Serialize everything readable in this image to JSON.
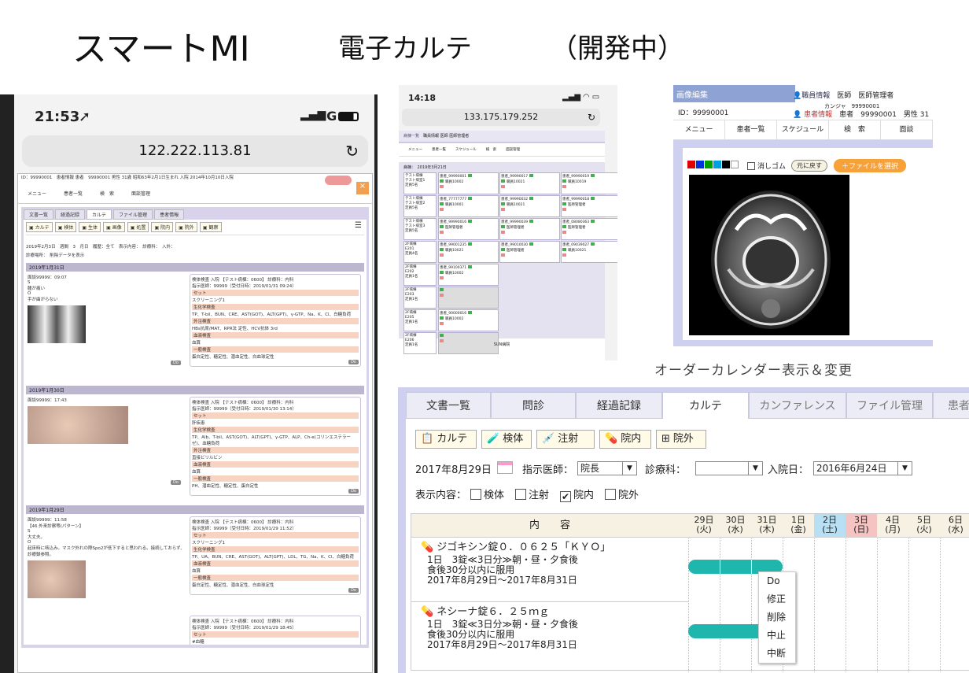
{
  "header": {
    "title": "スマートMI",
    "subtitle": "電子カルテ",
    "status": "（開発中）"
  },
  "phone1": {
    "time": "21:53",
    "signal": "4G",
    "url": "122.222.113.81",
    "patient_line": "ID：99990001　患者情報 患者　99990001 男性 31歳 昭和63年2月1日生まれ 入院 2014年10月10日入院",
    "menu": [
      "メニュー",
      "患者一覧",
      "検　索",
      "面談管理"
    ],
    "tabs": [
      "文書一覧",
      "経過記録",
      "カルテ",
      "ファイル管理",
      "患者情報"
    ],
    "tools": [
      "カルテ",
      "検体",
      "生体",
      "画像",
      "処置",
      "院内",
      "院外",
      "観察"
    ],
    "filter_line": "2019年2月3日　週間　3　月日　履歴：全て　表示内容：　診療科：　入外：",
    "filter_line2": "診療場所：　削除データを表示",
    "days": [
      {
        "date": "2019年1月31日",
        "time": "面談99999：09:07",
        "notes": [
          "S",
          "腫が痛い",
          "O",
          "手が曲がらない"
        ],
        "order_head": "検体検査 入院 【テスト病棟：0600】 診療科：内科",
        "order_sub": "指示医師：99999（受付日時：2019/01/31 09:24）",
        "items": [
          "セット",
          "スクリーニング1",
          "生化学検査",
          "TP、T-bil、BUN、CRE、AST(GOT)、ALT(GPT)、γ-GTP、Na、K、Cl、白糖負荷",
          "外注検査",
          "HBs抗原/MAT、RPR法 定性、HCV抗体 3rd",
          "血液検査",
          "血算",
          "一般検査",
          "蛋白定性、糖定性、潜血定性、白血球定性"
        ]
      },
      {
        "date": "2019年1月30日",
        "time": "面談99999：17:43",
        "order_head": "検体検査 入院 【テスト病棟：0600】 診療科：内科",
        "order_sub": "指示医師：99999（受付日時：2019/01/30 13:14）",
        "items": [
          "セット",
          "肝疾患",
          "生化学検査",
          "TP、Alb、T-bil、AST(GOT)、ALT(GPT)、γ-GTP、ALP、Ch-e(コリンエステラーゼ)、血糖負荷",
          "外注検査",
          "直接ビリルビン",
          "血液検査",
          "血算",
          "一般検査",
          "PH、潜血定性、糖定性、蛋白定性"
        ]
      },
      {
        "date": "2019年1月29日",
        "time": "面談99999：11:58",
        "notes": [
          "【46 外来診察等(パターン】",
          "S",
          "大丈夫。",
          "O",
          "起床時に咳込み。マスク外れの際Spo2が低下すると思われる。接続しておらず、診療録参照。"
        ],
        "order_head": "検体検査 入院 【テスト病棟：0600】 診療科：内科",
        "order_sub": "指示医師：99999（受付日時：2019/01/29 11:52）",
        "items": [
          "セット",
          "スクリーニング1",
          "生化学検査",
          "TP、UA、BUN、CRE、AST(GOT)、ALT(GPT)、LDL、TG、Na、K、Cl、白糖負荷",
          "血液検査",
          "血算",
          "一般検査",
          "蛋白定性、糖定性、潜血定性、白血球定性"
        ],
        "order2_head": "検体検査 入院 【テスト病棟：0600】 診療科：内科",
        "order2_sub": "指示医師：99999（受付日時：2019/01/29 18:45）",
        "items2": [
          "セット",
          "#血糖",
          "生化学検査",
          "TP、AST(GOT)、ALT(GPT)、γ-GTP、Che(コリンエステラーゼ)、CPK、HDL、LDL、TG、Na、K、Cl"
        ]
      }
    ],
    "do_label": "Do"
  },
  "phone2": {
    "time": "14:18",
    "url": "133.175.179.252",
    "header": "職員情報 医師 医師管理者",
    "menu": [
      "メニュー",
      "患者一覧",
      "スケジュール",
      "検　索",
      "面談管理"
    ],
    "date_line": "病棟：　2019年3月21日",
    "footer": "SUN病院",
    "rows": [
      {
        "room": [
          "テスト病棟",
          "テスト病室1",
          "定員5名"
        ],
        "cells": [
          "患者_99990001|職員10002",
          "患者_99990017|職員10021",
          "患者_99990019|職員10019"
        ]
      },
      {
        "room": [
          "テスト病棟",
          "テスト病室2",
          "定員5名"
        ],
        "cells": [
          "患者_77777777|職員10001",
          "患者_99990032|職員10021",
          "患者_99990018|医師管理者"
        ]
      },
      {
        "room": [
          "テスト病棟",
          "テスト病室3",
          "定員5名"
        ],
        "cells": [
          "患者_99990016|医師管理者",
          "患者_99990039|医師管理者",
          "患者_08080363|医師管理者"
        ]
      },
      {
        "room": [
          "2F病棟",
          "E201",
          "定員4名"
        ],
        "cells": [
          "患者_99001235|職員10021",
          "患者_99010030|医師管理者",
          "患者_09039027|職員10021"
        ]
      },
      {
        "room": [
          "2F病棟",
          "E202",
          "定員1名"
        ],
        "cells": [
          "患者_99100371|職員10002"
        ]
      },
      {
        "room": [
          "2F病棟",
          "E203",
          "定員1名"
        ],
        "cells": [
          ""
        ]
      },
      {
        "room": [
          "2F病棟",
          "E205",
          "定員1名"
        ],
        "cells": [
          "患者_90000016|職員10002"
        ]
      },
      {
        "room": [
          "2F病棟",
          "E206",
          "定員1名"
        ],
        "cells": [
          ""
        ]
      }
    ]
  },
  "mri": {
    "header": "画像編集",
    "id_line": "ID：99990001",
    "staff": "職員情報",
    "staff_val": "医師　医師管理者",
    "patient": "患者情報",
    "patient_kana": "カンジャ　99990001",
    "patient_val": "患者　99990001　男性 31",
    "menu": [
      "メニュー",
      "患者一覧",
      "スケジュール",
      "検　索",
      "面談"
    ],
    "swatches": [
      "#e00000",
      "#0030e0",
      "#00a000",
      "#00a0e0",
      "#000000",
      "#ffffff"
    ],
    "eraser": "消しゴム",
    "undo": "元に戻す",
    "file": "＋ファイルを選択",
    "caption": "オーダーカレンダー表示＆変更"
  },
  "karte": {
    "tabs": [
      "文書一覧",
      "問診",
      "経過記録",
      "カルテ",
      "カンファレンス",
      "ファイル管理",
      "患者情"
    ],
    "active_tab": 3,
    "tools": [
      {
        "icon": "chart",
        "label": "カルテ"
      },
      {
        "icon": "tube",
        "label": "検体"
      },
      {
        "icon": "syringe",
        "label": "注射"
      },
      {
        "icon": "pill",
        "label": "院内"
      },
      {
        "icon": "pills",
        "label": "院外"
      }
    ],
    "date": "2017年8月29日",
    "doctor_label": "指示医師：",
    "doctor": "院長",
    "dept_label": "診療科：",
    "dept": "",
    "adm_label": "入院日：",
    "adm": "2016年6月24日",
    "show_label": "表示内容：",
    "show_opts": [
      {
        "label": "検体",
        "checked": false
      },
      {
        "label": "注射",
        "checked": false
      },
      {
        "label": "院内",
        "checked": true
      },
      {
        "label": "院外",
        "checked": false
      }
    ],
    "content_hdr": "内　　容",
    "dates": [
      {
        "d": "29日",
        "w": "(火)"
      },
      {
        "d": "30日",
        "w": "(水)"
      },
      {
        "d": "31日",
        "w": "(木)"
      },
      {
        "d": "1日",
        "w": "(金)"
      },
      {
        "d": "2日",
        "w": "(土)"
      },
      {
        "d": "3日",
        "w": "(日)"
      },
      {
        "d": "4日",
        "w": "(月)"
      },
      {
        "d": "5日",
        "w": "(火)"
      },
      {
        "d": "6日",
        "w": "(水)"
      }
    ],
    "orders": [
      {
        "name": "ジゴキシン錠０．０６２５「ＫＹＯ」",
        "l1": "1日　3錠≪3日分≫朝・昼・夕食後",
        "l2": "食後30分以内に服用",
        "l3": "2017年8月29日～2017年8月31日",
        "span": 3
      },
      {
        "name": "ネシーナ錠６．２５ｍｇ",
        "l1": "1日　3錠≪3日分≫朝・昼・夕食後",
        "l2": "食後30分以内に服用",
        "l3": "2017年8月29日～2017年8月31日",
        "span": 3
      }
    ],
    "context_menu": [
      "Do",
      "修正",
      "削除",
      "中止",
      "中断"
    ]
  }
}
